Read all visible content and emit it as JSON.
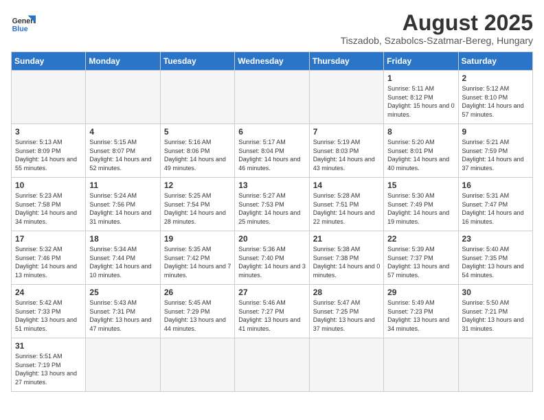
{
  "header": {
    "logo_general": "General",
    "logo_blue": "Blue",
    "month_year": "August 2025",
    "location": "Tiszadob, Szabolcs-Szatmar-Bereg, Hungary"
  },
  "weekdays": [
    "Sunday",
    "Monday",
    "Tuesday",
    "Wednesday",
    "Thursday",
    "Friday",
    "Saturday"
  ],
  "weeks": [
    [
      {
        "day": "",
        "info": ""
      },
      {
        "day": "",
        "info": ""
      },
      {
        "day": "",
        "info": ""
      },
      {
        "day": "",
        "info": ""
      },
      {
        "day": "",
        "info": ""
      },
      {
        "day": "1",
        "info": "Sunrise: 5:11 AM\nSunset: 8:12 PM\nDaylight: 15 hours and 0 minutes."
      },
      {
        "day": "2",
        "info": "Sunrise: 5:12 AM\nSunset: 8:10 PM\nDaylight: 14 hours and 57 minutes."
      }
    ],
    [
      {
        "day": "3",
        "info": "Sunrise: 5:13 AM\nSunset: 8:09 PM\nDaylight: 14 hours and 55 minutes."
      },
      {
        "day": "4",
        "info": "Sunrise: 5:15 AM\nSunset: 8:07 PM\nDaylight: 14 hours and 52 minutes."
      },
      {
        "day": "5",
        "info": "Sunrise: 5:16 AM\nSunset: 8:06 PM\nDaylight: 14 hours and 49 minutes."
      },
      {
        "day": "6",
        "info": "Sunrise: 5:17 AM\nSunset: 8:04 PM\nDaylight: 14 hours and 46 minutes."
      },
      {
        "day": "7",
        "info": "Sunrise: 5:19 AM\nSunset: 8:03 PM\nDaylight: 14 hours and 43 minutes."
      },
      {
        "day": "8",
        "info": "Sunrise: 5:20 AM\nSunset: 8:01 PM\nDaylight: 14 hours and 40 minutes."
      },
      {
        "day": "9",
        "info": "Sunrise: 5:21 AM\nSunset: 7:59 PM\nDaylight: 14 hours and 37 minutes."
      }
    ],
    [
      {
        "day": "10",
        "info": "Sunrise: 5:23 AM\nSunset: 7:58 PM\nDaylight: 14 hours and 34 minutes."
      },
      {
        "day": "11",
        "info": "Sunrise: 5:24 AM\nSunset: 7:56 PM\nDaylight: 14 hours and 31 minutes."
      },
      {
        "day": "12",
        "info": "Sunrise: 5:25 AM\nSunset: 7:54 PM\nDaylight: 14 hours and 28 minutes."
      },
      {
        "day": "13",
        "info": "Sunrise: 5:27 AM\nSunset: 7:53 PM\nDaylight: 14 hours and 25 minutes."
      },
      {
        "day": "14",
        "info": "Sunrise: 5:28 AM\nSunset: 7:51 PM\nDaylight: 14 hours and 22 minutes."
      },
      {
        "day": "15",
        "info": "Sunrise: 5:30 AM\nSunset: 7:49 PM\nDaylight: 14 hours and 19 minutes."
      },
      {
        "day": "16",
        "info": "Sunrise: 5:31 AM\nSunset: 7:47 PM\nDaylight: 14 hours and 16 minutes."
      }
    ],
    [
      {
        "day": "17",
        "info": "Sunrise: 5:32 AM\nSunset: 7:46 PM\nDaylight: 14 hours and 13 minutes."
      },
      {
        "day": "18",
        "info": "Sunrise: 5:34 AM\nSunset: 7:44 PM\nDaylight: 14 hours and 10 minutes."
      },
      {
        "day": "19",
        "info": "Sunrise: 5:35 AM\nSunset: 7:42 PM\nDaylight: 14 hours and 7 minutes."
      },
      {
        "day": "20",
        "info": "Sunrise: 5:36 AM\nSunset: 7:40 PM\nDaylight: 14 hours and 3 minutes."
      },
      {
        "day": "21",
        "info": "Sunrise: 5:38 AM\nSunset: 7:38 PM\nDaylight: 14 hours and 0 minutes."
      },
      {
        "day": "22",
        "info": "Sunrise: 5:39 AM\nSunset: 7:37 PM\nDaylight: 13 hours and 57 minutes."
      },
      {
        "day": "23",
        "info": "Sunrise: 5:40 AM\nSunset: 7:35 PM\nDaylight: 13 hours and 54 minutes."
      }
    ],
    [
      {
        "day": "24",
        "info": "Sunrise: 5:42 AM\nSunset: 7:33 PM\nDaylight: 13 hours and 51 minutes."
      },
      {
        "day": "25",
        "info": "Sunrise: 5:43 AM\nSunset: 7:31 PM\nDaylight: 13 hours and 47 minutes."
      },
      {
        "day": "26",
        "info": "Sunrise: 5:45 AM\nSunset: 7:29 PM\nDaylight: 13 hours and 44 minutes."
      },
      {
        "day": "27",
        "info": "Sunrise: 5:46 AM\nSunset: 7:27 PM\nDaylight: 13 hours and 41 minutes."
      },
      {
        "day": "28",
        "info": "Sunrise: 5:47 AM\nSunset: 7:25 PM\nDaylight: 13 hours and 37 minutes."
      },
      {
        "day": "29",
        "info": "Sunrise: 5:49 AM\nSunset: 7:23 PM\nDaylight: 13 hours and 34 minutes."
      },
      {
        "day": "30",
        "info": "Sunrise: 5:50 AM\nSunset: 7:21 PM\nDaylight: 13 hours and 31 minutes."
      }
    ],
    [
      {
        "day": "31",
        "info": "Sunrise: 5:51 AM\nSunset: 7:19 PM\nDaylight: 13 hours and 27 minutes."
      },
      {
        "day": "",
        "info": ""
      },
      {
        "day": "",
        "info": ""
      },
      {
        "day": "",
        "info": ""
      },
      {
        "day": "",
        "info": ""
      },
      {
        "day": "",
        "info": ""
      },
      {
        "day": "",
        "info": ""
      }
    ]
  ]
}
